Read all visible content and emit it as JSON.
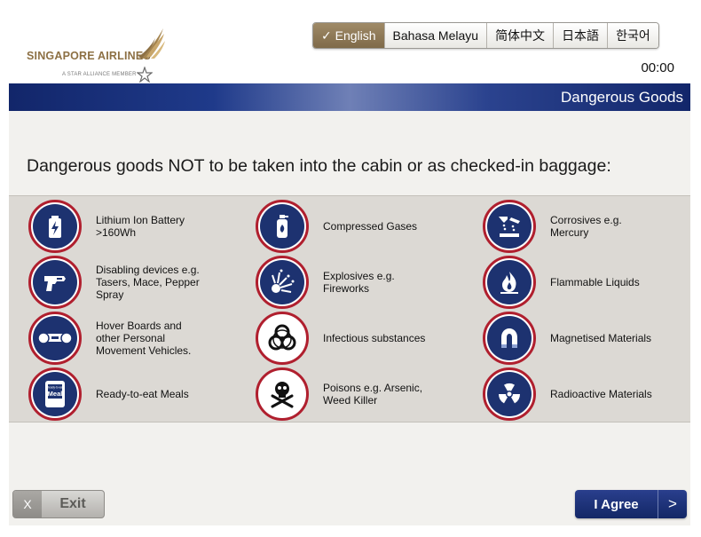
{
  "brand": {
    "name": "SINGAPORE AIRLINES",
    "tagline": "A STAR ALLIANCE MEMBER",
    "gold": "#8d7044",
    "navy": "#1d3270",
    "red": "#b01f2e"
  },
  "languages": [
    {
      "label": "✓ English",
      "active": true
    },
    {
      "label": "Bahasa Melayu",
      "active": false
    },
    {
      "label": "简体中文",
      "active": false
    },
    {
      "label": "日本語",
      "active": false
    },
    {
      "label": "한국어",
      "active": false
    }
  ],
  "timer": "00:00",
  "page_title": "Dangerous Goods",
  "message": "Dangerous goods NOT to be taken into the cabin or as checked-in baggage:",
  "goods": [
    {
      "label": "Lithium Ion Battery\n>160Wh",
      "icon": "battery-icon"
    },
    {
      "label": "Compressed Gases",
      "icon": "gas-canister-icon"
    },
    {
      "label": "Corrosives e.g.\nMercury",
      "icon": "corrosive-icon"
    },
    {
      "label": "Disabling devices e.g.\nTasers, Mace, Pepper\nSpray",
      "icon": "taser-icon"
    },
    {
      "label": "Explosives e.g.\nFireworks",
      "icon": "explosion-icon"
    },
    {
      "label": "Flammable Liquids",
      "icon": "flame-icon"
    },
    {
      "label": "Hover Boards and\nother Personal\nMovement Vehicles.",
      "icon": "hoverboard-icon"
    },
    {
      "label": "Infectious substances",
      "icon": "biohazard-icon"
    },
    {
      "label": "Magnetised Materials",
      "icon": "magnet-icon"
    },
    {
      "label": "Ready-to-eat Meals",
      "icon": "meal-pack-icon"
    },
    {
      "label": "Poisons e.g. Arsenic,\nWeed Killer",
      "icon": "skull-crossbones-icon"
    },
    {
      "label": "Radioactive Materials",
      "icon": "radioactive-icon"
    }
  ],
  "meal_pack_text": {
    "small": "Ready-to-eat",
    "big": "Meal"
  },
  "exit": {
    "x": "X",
    "label": "Exit"
  },
  "agree": {
    "label": "I Agree",
    "arrow": ">"
  }
}
